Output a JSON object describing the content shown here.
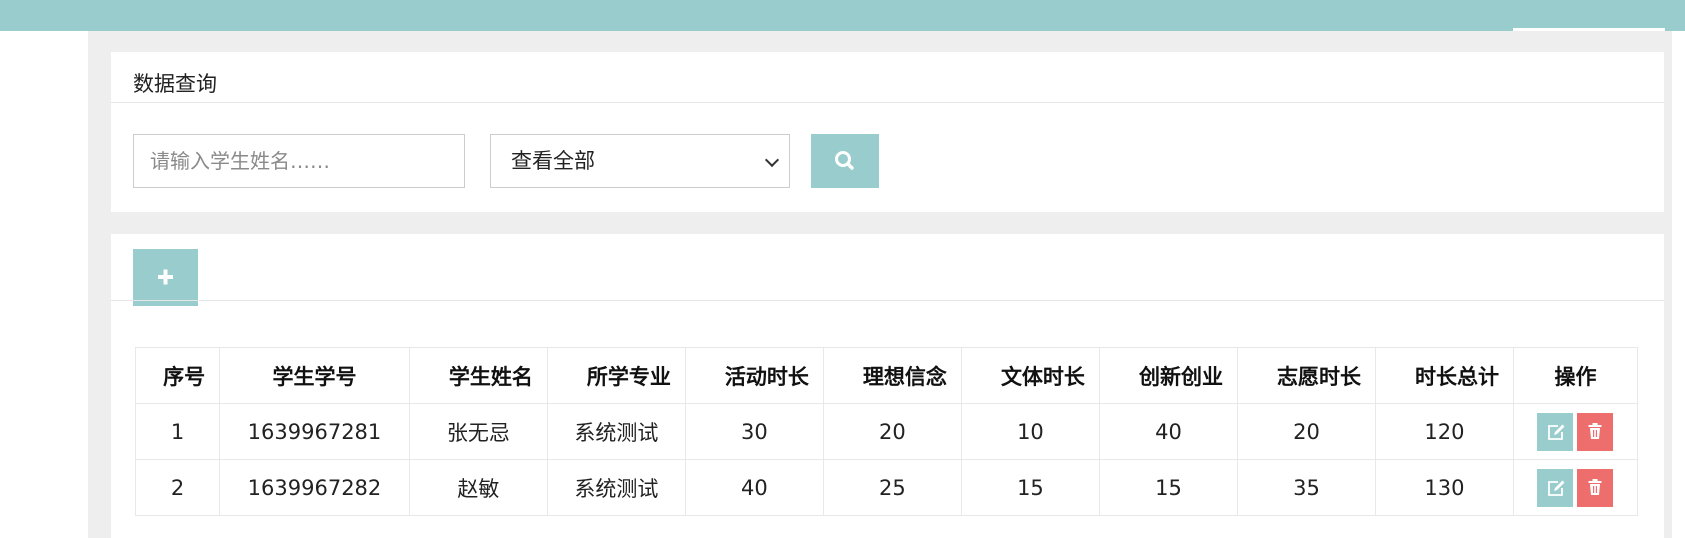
{
  "search_panel": {
    "title": "数据查询",
    "search_placeholder": "请输入学生姓名……",
    "filter_selected": "查看全部",
    "icons": {
      "search": "search-icon",
      "select_arrow": "chevron-down-icon"
    }
  },
  "table_panel": {
    "icons": {
      "add": "plus-icon",
      "edit": "edit-icon",
      "delete": "trash-icon"
    },
    "headers": [
      "序号",
      "学生学号",
      "学生姓名",
      "所学专业",
      "活动时长",
      "理想信念",
      "文体时长",
      "创新创业",
      "志愿时长",
      "时长总计",
      "操作"
    ],
    "rows": [
      [
        "1",
        "1639967281",
        "张无忌",
        "系统测试",
        "30",
        "20",
        "10",
        "40",
        "20",
        "120"
      ],
      [
        "2",
        "1639967282",
        "赵敏",
        "系统测试",
        "40",
        "25",
        "15",
        "15",
        "35",
        "130"
      ]
    ]
  },
  "colors": {
    "accent": "#99cccc",
    "danger": "#ee6e6e",
    "background": "#eeeeee"
  }
}
